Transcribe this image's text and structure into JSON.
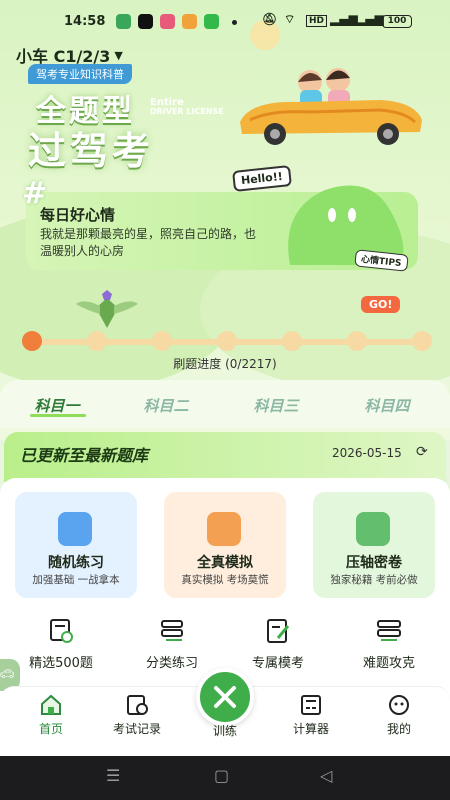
{
  "status_bar": {
    "time": "14:58",
    "battery": "100",
    "network": "HD"
  },
  "header": {
    "vehicle_type": "小车 C1/2/3",
    "subtitle": "驾考专业知识科普",
    "title_line1": "全题型",
    "title_line2": "过驾考",
    "title_en_line1": "Entire",
    "title_en_line2": "DRIVER LICENSE"
  },
  "mood": {
    "title": "每日好心情",
    "text": "我就是那颗最亮的星，照亮自己的路，也温暖别人的心房",
    "hello": "Hello!!",
    "tips": "心情TIPS"
  },
  "progress": {
    "go_label": "GO!",
    "label": "刷题进度 (0/2217)",
    "done": 0,
    "total": 2217
  },
  "subject_tabs": [
    {
      "label": "科目一",
      "active": true
    },
    {
      "label": "科目二",
      "active": false
    },
    {
      "label": "科目三",
      "active": false
    },
    {
      "label": "科目四",
      "active": false
    }
  ],
  "question_bank": {
    "status": "已更新至最新题库",
    "date": "2026-05-15"
  },
  "practice_modes": [
    {
      "title": "随机练习",
      "desc": "加强基础 一战拿本",
      "color": "#e4f1ff",
      "icon_color": "#5aa3ee"
    },
    {
      "title": "全真模拟",
      "desc": "真实模拟 考场莫慌",
      "color": "#ffeedd",
      "icon_color": "#f4a053"
    },
    {
      "title": "压轴密卷",
      "desc": "独家秘籍 考前必做",
      "color": "#e3f7dc",
      "icon_color": "#63bf6d"
    }
  ],
  "quick_actions": [
    {
      "label": "精选500题"
    },
    {
      "label": "分类练习"
    },
    {
      "label": "专属模考"
    },
    {
      "label": "难题攻克"
    }
  ],
  "bottom_nav": [
    {
      "label": "首页",
      "active": true
    },
    {
      "label": "考试记录",
      "active": false
    },
    {
      "label": "训练",
      "active": false
    },
    {
      "label": "计算器",
      "active": false
    },
    {
      "label": "我的",
      "active": false
    }
  ],
  "colors": {
    "accent": "#3fae4a",
    "progress_start": "#f07f3c",
    "go": "#f4683f"
  }
}
